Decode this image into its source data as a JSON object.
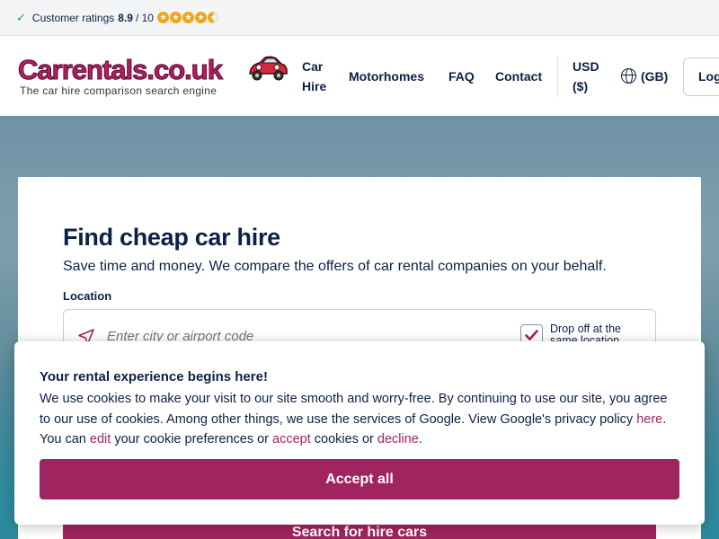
{
  "topbar": {
    "rating_label": "Customer ratings",
    "rating_value": "8.9",
    "rating_scale": "/ 10",
    "stars_filled": 4.5,
    "check_icon": "check-icon"
  },
  "header": {
    "logo_text": "Carrentals.co.uk",
    "logo_tagline": "The car hire comparison search engine",
    "nav": {
      "car_hire": "Car Hire",
      "motorhomes": "Motorhomes",
      "faq": "FAQ",
      "contact": "Contact",
      "currency": "USD ($)",
      "language": "(GB)",
      "login": "Log"
    }
  },
  "search": {
    "title": "Find cheap car hire",
    "subtitle": "Save time and money. We compare the offers of car rental companies on your behalf.",
    "location_label": "Location",
    "location_placeholder": "Enter city or airport code",
    "dropoff_label": "Drop off at the same location",
    "dropoff_checked": true,
    "search_button": "Search for hire cars"
  },
  "cookie": {
    "title": "Your rental experience begins here!",
    "text_1": "We use cookies to make your visit to our site smooth and worry-free. By continuing to use our site, you agree to our use of cookies. Among other things, we use the services of Google. View Google's privacy policy ",
    "link_here": "here",
    "text_2": ". You can ",
    "link_edit": "edit",
    "text_3": " your cookie preferences or ",
    "link_accept": "accept",
    "text_4": " cookies or ",
    "link_decline": "decline",
    "text_5": ".",
    "accept_all": "Accept all"
  },
  "colors": {
    "brand": "#a0245f",
    "navy": "#0b2245",
    "star": "#f2a516"
  }
}
